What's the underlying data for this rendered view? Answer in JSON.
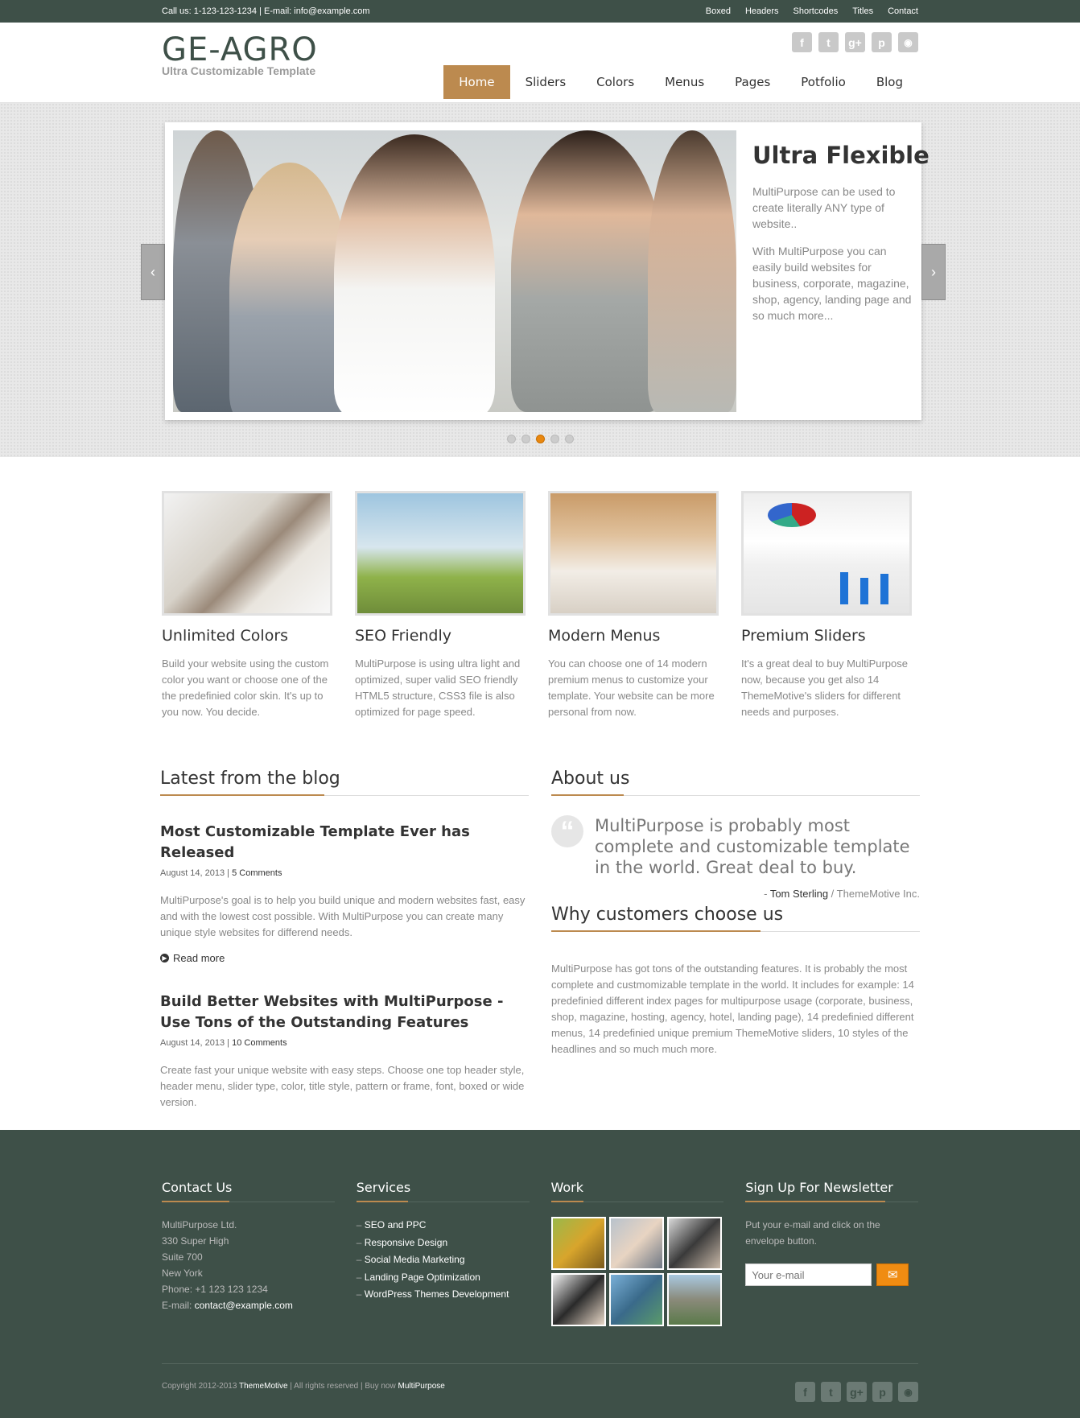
{
  "topbar": {
    "contact": "Call us: 1-123-123-1234 | E-mail: info@example.com",
    "links": [
      "Boxed",
      "Headers",
      "Shortcodes",
      "Titles",
      "Contact"
    ]
  },
  "header": {
    "logo": "GE-AGRO",
    "tagline": "Ultra Customizable Template",
    "social": [
      "f",
      "t",
      "g+",
      "p",
      "rss"
    ],
    "nav": [
      "Home",
      "Sliders",
      "Colors",
      "Menus",
      "Pages",
      "Potfolio",
      "Blog"
    ],
    "nav_active": "Home"
  },
  "slider": {
    "title": "Ultra Flexible",
    "p1": "MultiPurpose can be used to create literally ANY type of website..",
    "p2": "With MultiPurpose you can easily build websites for business, corporate, magazine, shop, agency, landing page and so much more...",
    "prev_icon": "chevron-left-icon",
    "next_icon": "chevron-right-icon",
    "dots_count": 5,
    "dot_active": 3
  },
  "features": [
    {
      "title": "Unlimited Colors",
      "text": "Build your website using the custom color you want or choose one of the the predefinied color skin. It's up to you now. You decide."
    },
    {
      "title": "SEO Friendly",
      "text": "MultiPurpose is using ultra light and optimized, super valid SEO friendly HTML5 structure, CSS3 file is also optimized for page speed."
    },
    {
      "title": "Modern Menus",
      "text": "You can choose one of 14 modern premium menus to customize your template. Your website can be more personal from now."
    },
    {
      "title": "Premium Sliders",
      "text": "It's a great deal to buy MultiPurpose now, because you get also 14 ThemeMotive's sliders for different needs and purposes."
    }
  ],
  "blog": {
    "heading": "Latest from the blog",
    "posts": [
      {
        "title": "Most Customizable Template Ever has Released",
        "date": "August 14, 2013",
        "comments": "5 Comments",
        "text": "MultiPurpose's goal is to help you build unique and modern websites fast, easy and with the lowest cost possible. With MultiPurpose you can create many unique style websites for differend needs.",
        "readmore": "Read more"
      },
      {
        "title": "Build Better Websites with MultiPurpose - Use Tons of the Outstanding Features",
        "date": "August 14, 2013",
        "comments": "10 Comments",
        "text": "Create fast your unique website with easy steps. Choose one top header style, header menu, slider type, color, title style, pattern or frame, font, boxed or wide version."
      }
    ]
  },
  "about": {
    "heading": "About us",
    "quote": "MultiPurpose is probably most complete and customizable template in the world. Great deal to buy.",
    "author": "Tom Sterling",
    "company": "ThemeMotive Inc.",
    "why_heading": "Why customers choose us",
    "why_text": "MultiPurpose has got tons of the outstanding features. It is probably the most complete and custmomizable template in the world. It includes for example: 14 predefinied different index pages for multipurpose usage (corporate, business, shop, magazine, hosting, agency, hotel, landing page), 14 predefinied different menus, 14 predefinied unique premium ThemeMotive sliders, 10 styles of the headlines and so much much more."
  },
  "footer": {
    "contact": {
      "heading": "Contact Us",
      "lines": [
        "MultiPurpose Ltd.",
        "330 Super High",
        "Suite 700",
        "New York",
        "Phone: +1 123 123 1234"
      ],
      "email_label": "E-mail: ",
      "email": "contact@example.com"
    },
    "services": {
      "heading": "Services",
      "items": [
        "SEO and PPC",
        "Responsive Design",
        "Social Media Marketing",
        "Landing Page Optimization",
        "WordPress Themes Development"
      ]
    },
    "work": {
      "heading": "Work"
    },
    "newsletter": {
      "heading": "Sign Up For Newsletter",
      "text": "Put your e-mail and click on the envelope button.",
      "placeholder": "Your e-mail",
      "button_icon": "envelope-icon"
    },
    "copyright": "Copyright 2012-2013 ",
    "brand": "ThemeMotive",
    "rights": " | All rights reserved | Buy now ",
    "product": "MultiPurpose",
    "social": [
      "f",
      "t",
      "g+",
      "p",
      "rss"
    ]
  },
  "colors": {
    "accent": "#bc8a4f",
    "dark": "#3e5048",
    "orange": "#f08c12"
  }
}
